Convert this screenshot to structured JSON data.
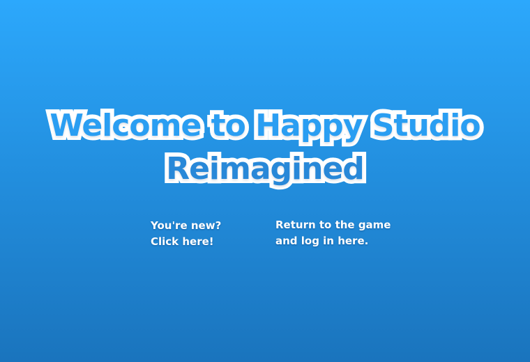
{
  "welcome": {
    "title_line1": "Welcome to Happy Studio",
    "title_line2": "Reimagined"
  },
  "options": {
    "new_user": {
      "line1": "You're new?",
      "line2": "Click here!"
    },
    "returning_user": {
      "line1": "Return to the game",
      "line2": "and log in here."
    }
  },
  "colors": {
    "background_top": "#2ca8fc",
    "background_bottom": "#1a74bd",
    "title_fill": "#2a9ef2",
    "title_outline": "#ffffff",
    "option_text": "#ffffff"
  }
}
